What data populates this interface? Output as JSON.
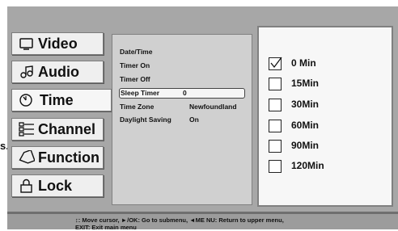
{
  "stray_text": "s.",
  "nav": {
    "items": [
      {
        "label": "Video",
        "icon": "screen-icon"
      },
      {
        "label": "Audio",
        "icon": "music-note-icon"
      },
      {
        "label": "Time",
        "icon": "clock-icon",
        "selected": true
      },
      {
        "label": "Channel",
        "icon": "channel-list-icon"
      },
      {
        "label": "Function",
        "icon": "tag-icon"
      },
      {
        "label": "Lock",
        "icon": "lock-icon"
      }
    ]
  },
  "time_menu": {
    "rows": [
      {
        "label": "Date/Time",
        "value": ""
      },
      {
        "label": "Timer On",
        "value": ""
      },
      {
        "label": "Timer Off",
        "value": ""
      },
      {
        "label": "Sleep Timer",
        "value": "0",
        "selected": true
      },
      {
        "label": "Time Zone",
        "value": "Newfoundland"
      },
      {
        "label": "Daylight Saving",
        "value": "On"
      }
    ]
  },
  "sleep_options": [
    {
      "label": "0 Min",
      "checked": true
    },
    {
      "label": "15Min",
      "checked": false
    },
    {
      "label": "30Min",
      "checked": false
    },
    {
      "label": "60Min",
      "checked": false
    },
    {
      "label": "90Min",
      "checked": false
    },
    {
      "label": "120Min",
      "checked": false
    }
  ],
  "help": {
    "line1": "↕: Move cursor, ►/OK: Go to submenu, ◄ME NU: Return to upper menu,",
    "line2": "EXIT: Exit main menu"
  },
  "colors": {
    "frame": "#a7a7a7",
    "panel": "#d0d0d0",
    "highlight": "#f6f6f6"
  }
}
